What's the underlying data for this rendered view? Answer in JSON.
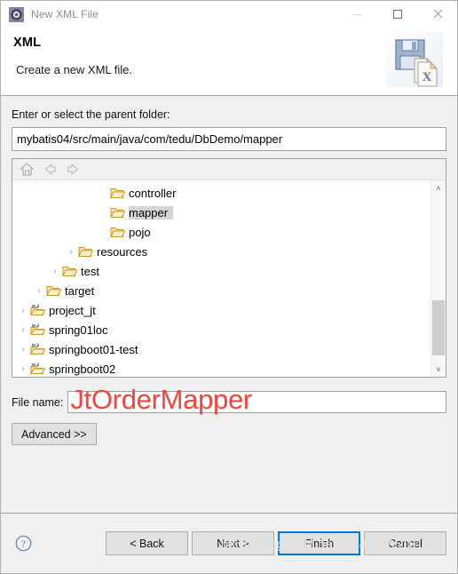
{
  "window": {
    "title": "New XML File",
    "icon": "xml-wizard-icon",
    "buttons": {
      "minimize": "minimize-icon",
      "maximize": "maximize-icon",
      "close": "close-icon"
    }
  },
  "header": {
    "title": "XML",
    "subtitle": "Create a new XML file.",
    "icon": "floppy-xml-file-icon"
  },
  "parent_folder": {
    "label": "Enter or select the parent folder:",
    "value": "mybatis04/src/main/java/com/tedu/DbDemo/mapper"
  },
  "tree": {
    "toolbar": [
      {
        "name": "home-icon",
        "label": "Home",
        "enabled": false
      },
      {
        "name": "back-arrow-icon",
        "label": "Back",
        "enabled": false
      },
      {
        "name": "forward-arrow-icon",
        "label": "Forward",
        "enabled": false
      }
    ],
    "rows": [
      {
        "label": "controller",
        "indent": 5,
        "twisty": "",
        "icon": "folder-icon",
        "selected": false
      },
      {
        "label": "mapper",
        "indent": 5,
        "twisty": "",
        "icon": "folder-icon",
        "selected": true
      },
      {
        "label": "pojo",
        "indent": 5,
        "twisty": "",
        "icon": "folder-icon",
        "selected": false
      },
      {
        "label": "resources",
        "indent": 3,
        "twisty": "›",
        "icon": "folder-icon",
        "selected": false
      },
      {
        "label": "test",
        "indent": 2,
        "twisty": "›",
        "icon": "folder-icon",
        "selected": false
      },
      {
        "label": "target",
        "indent": 1,
        "twisty": "›",
        "icon": "folder-icon",
        "selected": false
      },
      {
        "label": "project_jt",
        "indent": 0,
        "twisty": "›",
        "icon": "maven-project-icon",
        "selected": false
      },
      {
        "label": "spring01loc",
        "indent": 0,
        "twisty": "›",
        "icon": "maven-project-icon",
        "selected": false
      },
      {
        "label": "springboot01-test",
        "indent": 0,
        "twisty": "›",
        "icon": "maven-project-icon",
        "selected": false
      },
      {
        "label": "springboot02",
        "indent": 0,
        "twisty": "›",
        "icon": "maven-project-icon",
        "selected": false
      }
    ],
    "scrollbar": {
      "up_glyph": "˄",
      "down_glyph": "˅"
    }
  },
  "file_name": {
    "label": "File name:",
    "value": "",
    "annotation": "JtOrderMapper",
    "annotation_color": "#f4433a"
  },
  "advanced": {
    "label": "Advanced >>"
  },
  "footer": {
    "help_icon": "help-question-icon",
    "buttons": [
      {
        "label": "< Back",
        "name": "back-button",
        "default": false,
        "enabled": true
      },
      {
        "label": "Next >",
        "name": "next-button",
        "default": false,
        "enabled": true
      },
      {
        "label": "Finish",
        "name": "finish-button",
        "default": true,
        "enabled": true
      },
      {
        "label": "Cancel",
        "name": "cancel-button",
        "default": false,
        "enabled": true
      }
    ],
    "watermark": "https://blog.csdn.net/QQ404605101 8 2"
  }
}
